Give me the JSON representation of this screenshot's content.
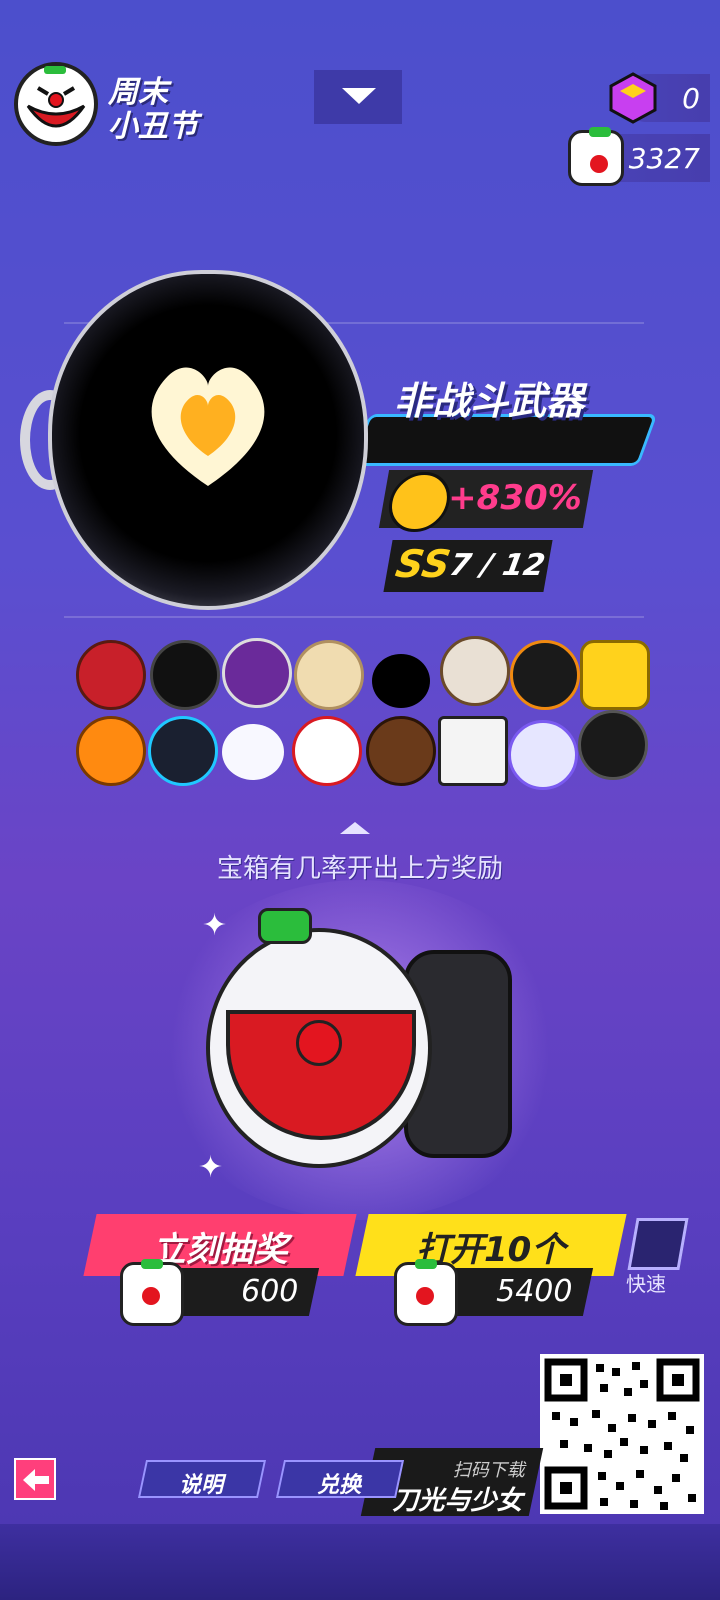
{
  "header": {
    "event_title_line1": "周末",
    "event_title_line2": "小丑节",
    "gem_count": "0",
    "chest_count": "3327"
  },
  "weapon": {
    "name": "非战斗武器",
    "bonus": "+830%",
    "rank_grade": "SS",
    "rank_count": "7 / 12"
  },
  "rewards": {
    "row1": [
      "nutcracker-head",
      "black-hair-halo",
      "purple-helmet",
      "blonde-hair",
      "black-blob",
      "skull-mask",
      "black-gold-helmet",
      "yellow-block-head"
    ],
    "row2": [
      "pumpkin-head",
      "blue-visor-helmet",
      "white-ghost",
      "clown-head",
      "bear-head",
      "box-head",
      "fish-head",
      "grim-reaper"
    ],
    "hint": "宝箱有几率开出上方奖励"
  },
  "actions": {
    "draw_now_label": "立刻抽奖",
    "draw_now_price": "600",
    "open_ten_label": "打开10个",
    "open_ten_price": "5400",
    "quick_label": "快速"
  },
  "footer": {
    "info_tab": "说明",
    "exchange_tab": "兑换",
    "promo_sub": "扫码下载",
    "promo_title": "刀光与少女"
  },
  "colors": {
    "accent_pink": "#ff3f6f",
    "accent_yellow": "#ffe01a",
    "bonus_pink": "#ff3c8c",
    "grade_yellow": "#ffd21c"
  }
}
